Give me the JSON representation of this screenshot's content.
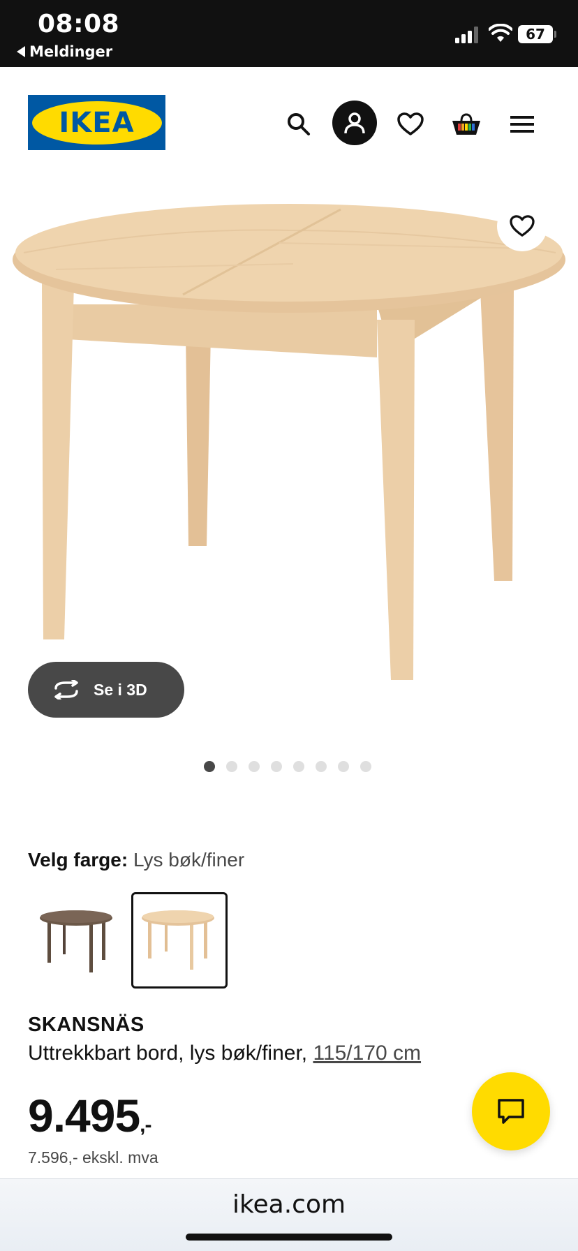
{
  "status_bar": {
    "time": "08:08",
    "back_label": "Meldinger",
    "battery": "67"
  },
  "header": {
    "logo_text": "IKEA"
  },
  "gallery": {
    "view_3d_label": "Se i 3D",
    "dots_total": 8,
    "dots_active_index": 0
  },
  "color_select": {
    "label": "Velg farge:",
    "value": "Lys bøk/finer"
  },
  "product": {
    "name": "SKANSNÄS",
    "description": "Uttrekkbart bord, lys bøk/finer,",
    "size_link": "115/170 cm",
    "price": "9.495",
    "price_suffix": ",-",
    "price_ex_vat": "7.596,- ekskl. mva"
  },
  "browser": {
    "url": "ikea.com"
  },
  "colors": {
    "ikea_blue": "#0058a3",
    "ikea_yellow": "#ffdb00",
    "table_wood": "#e8c9a0",
    "swatch_dark": "#6b5848"
  }
}
